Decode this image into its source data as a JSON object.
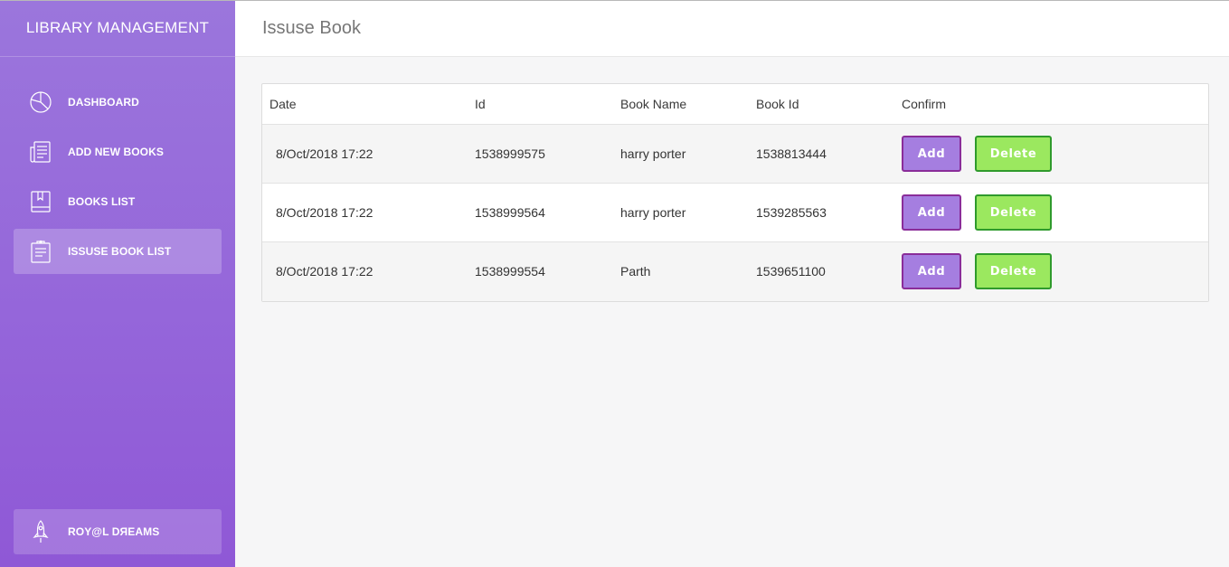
{
  "app": {
    "title": "LIBRARY MANAGEMENT"
  },
  "sidebar": {
    "items": [
      {
        "label": "DASHBOARD",
        "icon": "pie-chart-icon"
      },
      {
        "label": "ADD NEW BOOKS",
        "icon": "newspaper-icon"
      },
      {
        "label": "BOOKS LIST",
        "icon": "book-icon"
      },
      {
        "label": "ISSUSE BOOK LIST",
        "icon": "clipboard-icon",
        "active": true
      }
    ],
    "footer": {
      "label": "ROY@L DЯEAMS",
      "icon": "rocket-icon"
    }
  },
  "header": {
    "title": "Issuse Book"
  },
  "table": {
    "columns": [
      "Date",
      "Id",
      "Book Name",
      "Book Id",
      "Confirm"
    ],
    "rows": [
      {
        "date": "8/Oct/2018 17:22",
        "id": "1538999575",
        "book_name": "harry porter",
        "book_id": "1538813444"
      },
      {
        "date": "8/Oct/2018 17:22",
        "id": "1538999564",
        "book_name": "harry porter",
        "book_id": "1539285563"
      },
      {
        "date": "8/Oct/2018 17:22",
        "id": "1538999554",
        "book_name": "Parth",
        "book_id": "1539651100"
      }
    ],
    "add_label": "Add",
    "delete_label": "Delete"
  },
  "colors": {
    "sidebar_top": "#9b76dc",
    "sidebar_bottom": "#8f58d6",
    "add_button": "#a57ee0",
    "add_border": "#8a2d99",
    "delete_button": "#9be85f",
    "delete_border": "#2f9a2c"
  }
}
